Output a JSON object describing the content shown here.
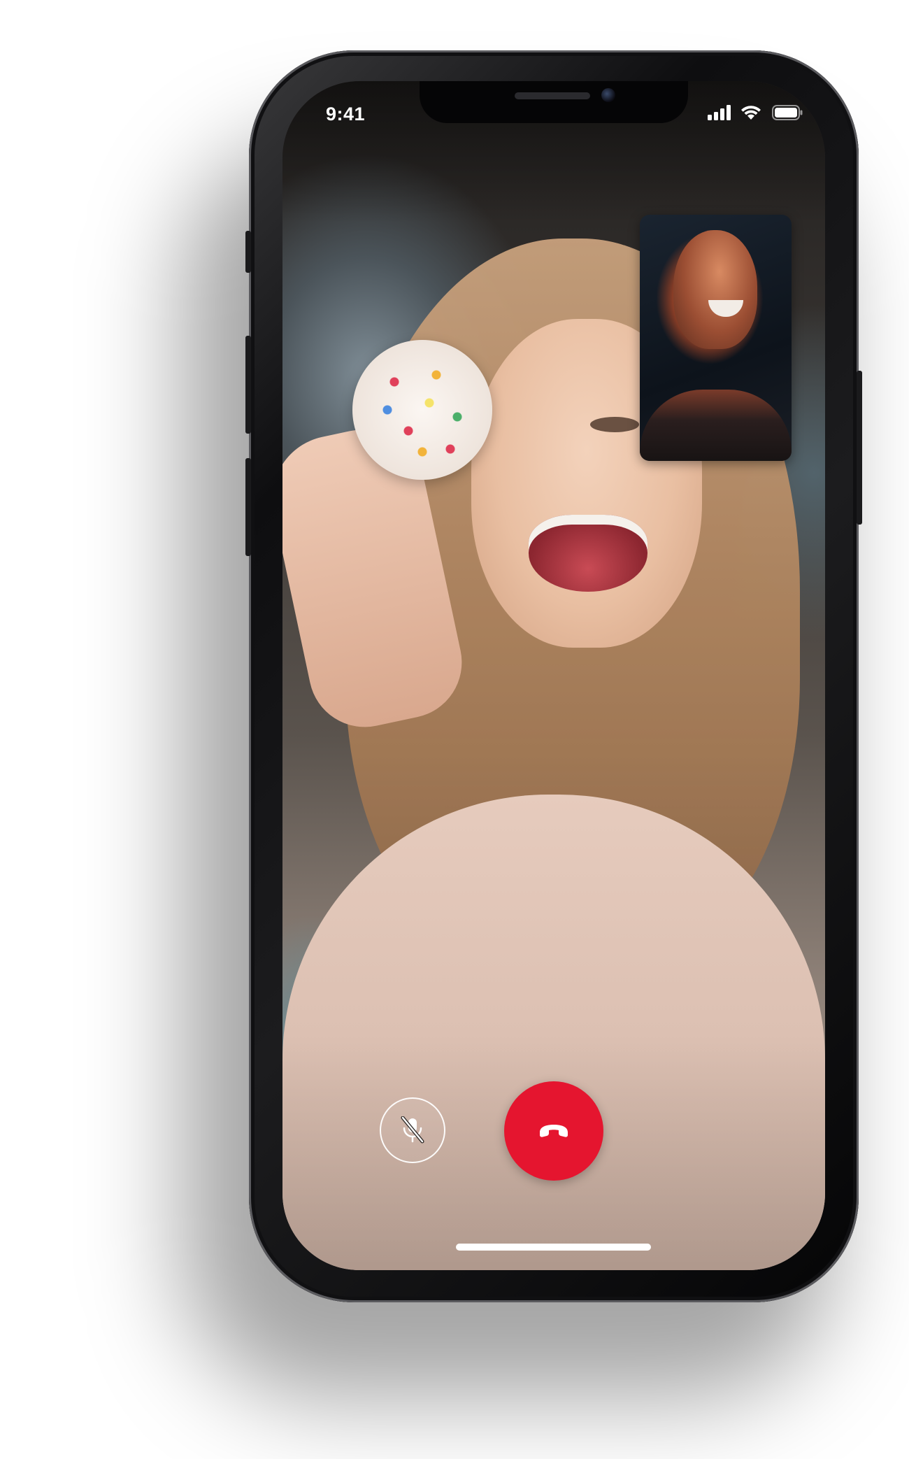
{
  "status_bar": {
    "time": "9:41",
    "icons": [
      "cellular-signal-icon",
      "wifi-icon",
      "battery-icon"
    ]
  },
  "call": {
    "remote_video": "main-video-feed",
    "self_video": "picture-in-picture-feed",
    "controls": {
      "mute_icon": "microphone-muted-icon",
      "end_call_icon": "phone-hangup-icon"
    }
  },
  "colors": {
    "end_call": "#e5152f",
    "status_text": "#ffffff"
  }
}
